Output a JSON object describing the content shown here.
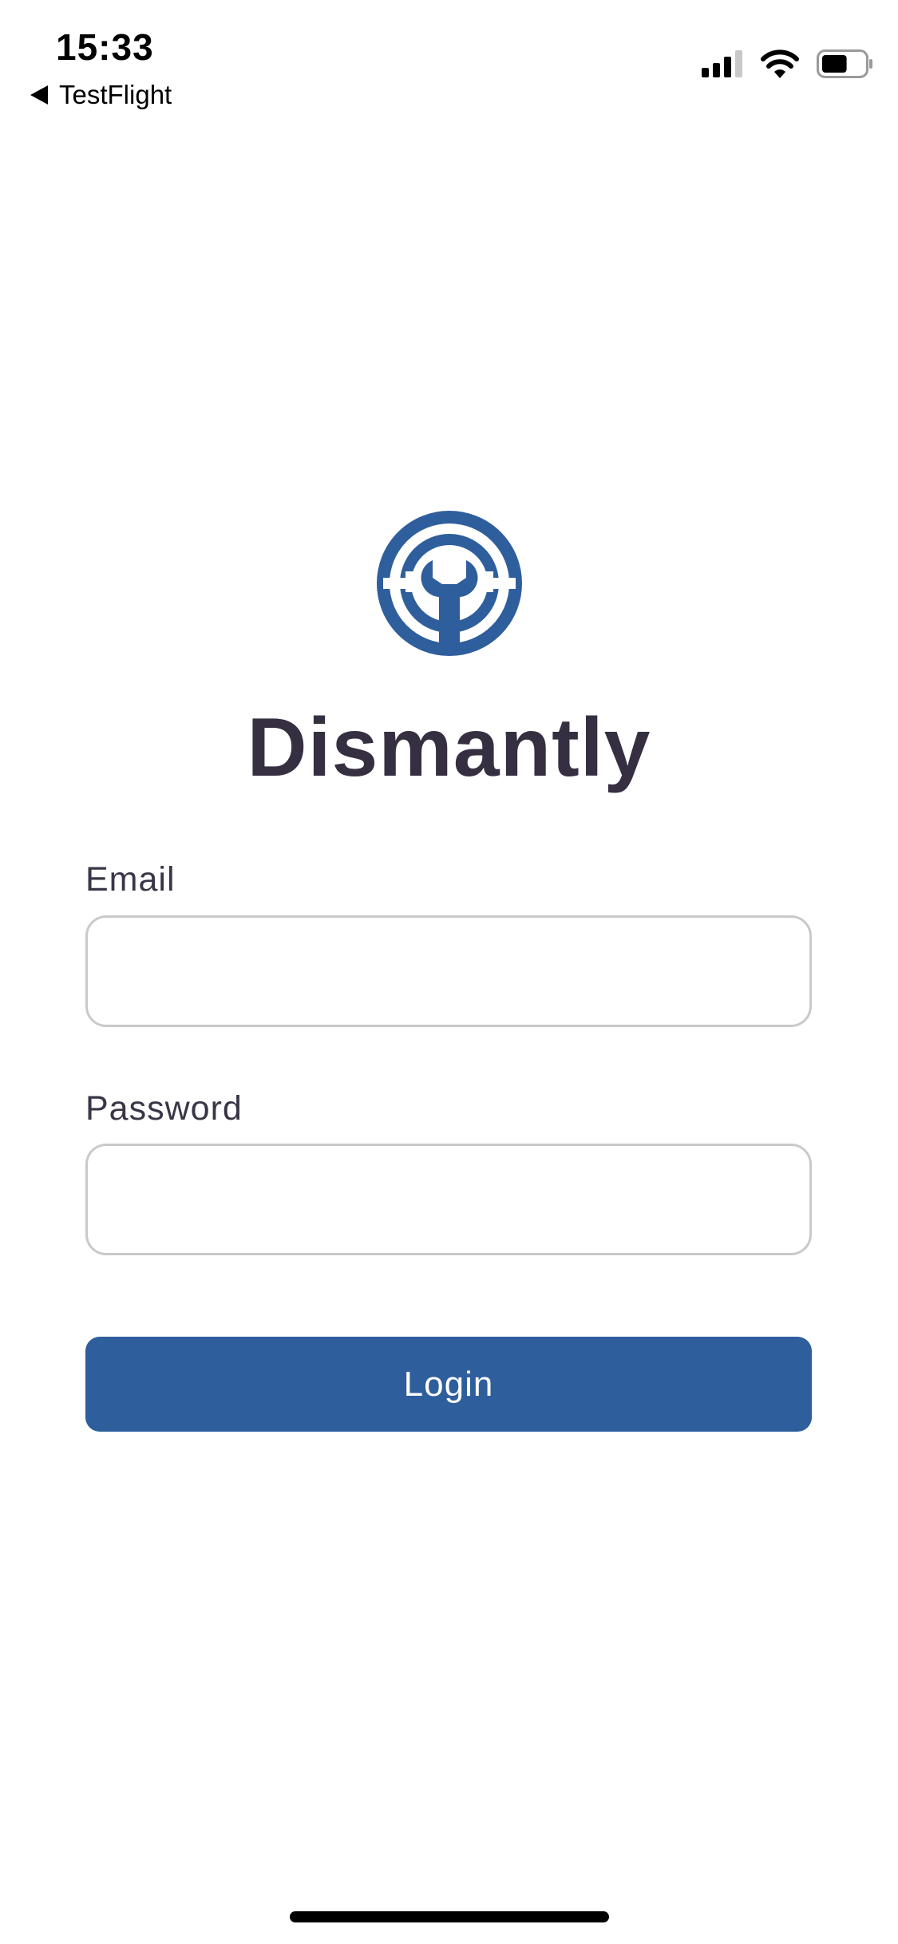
{
  "status_bar": {
    "time": "15:33",
    "back_label": "TestFlight",
    "icons": [
      "cellular-signal-icon",
      "wifi-icon",
      "battery-icon"
    ],
    "battery_level": 0.6
  },
  "app": {
    "title": "Dismantly",
    "logo_icon": "wrench-circle-logo"
  },
  "form": {
    "email_label": "Email",
    "email_value": "",
    "password_label": "Password",
    "password_value": "",
    "login_label": "Login"
  },
  "colors": {
    "accent": "#2e5e9c",
    "text": "#352f41",
    "input_border": "#c9c9c9"
  }
}
